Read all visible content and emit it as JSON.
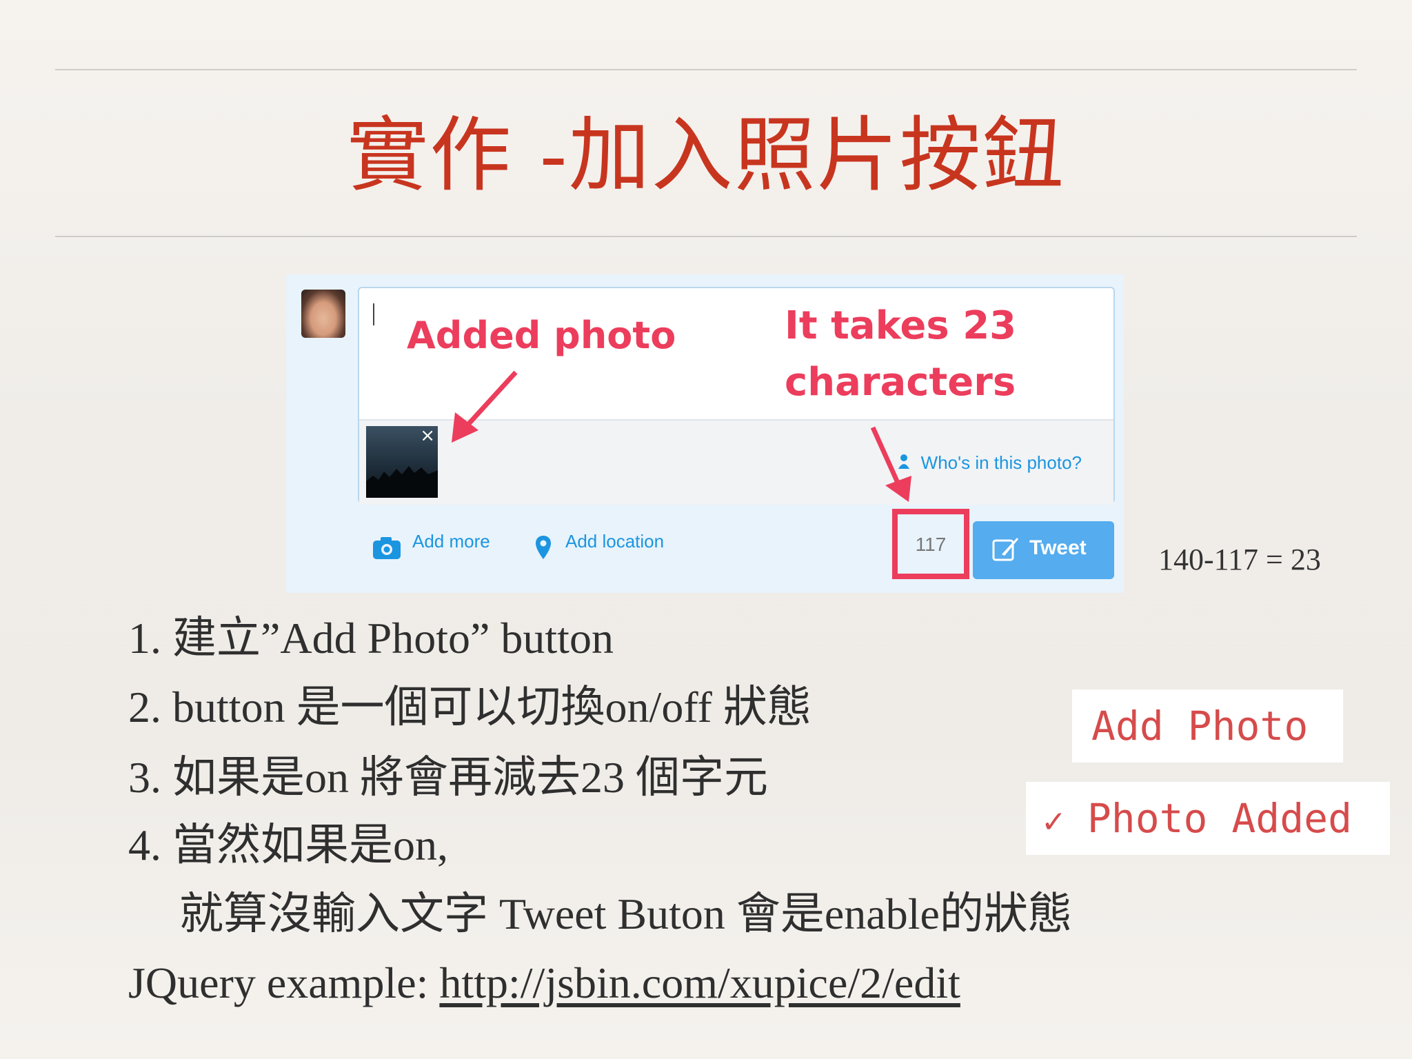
{
  "slide": {
    "title": "實作 -加入照片按鈕"
  },
  "tweet_composer": {
    "who_in_photo": "Who's in this photo?",
    "remove_photo_symbol": "×",
    "add_more_label": "Add more",
    "add_location_label": "Add location",
    "char_counter": "117",
    "tweet_button_label": "Tweet"
  },
  "annotations": {
    "added_photo": "Added photo",
    "takes_23_line1": "It takes 23",
    "takes_23_line2": "characters"
  },
  "calculation": "140-117 = 23",
  "steps": [
    "1. 建立”Add Photo” button",
    "2. button 是一個可以切換on/off 狀態",
    "3. 如果是on 將會再減去23 個字元",
    "4. 當然如果是on,",
    "就算沒輸入文字 Tweet Buton 會是enable的狀態"
  ],
  "jquery": {
    "prefix": "JQuery example: ",
    "link": "http://jsbin.com/xupice/2/edit"
  },
  "toggle_demo": {
    "off_label": "Add Photo",
    "on_check": "✓",
    "on_label": "Photo Added"
  },
  "colors": {
    "title_red": "#c8351f",
    "annotation_pink": "#ec3d5c",
    "twitter_blue": "#55acee",
    "link_blue": "#1b95e0",
    "demo_red": "#d64b4b"
  }
}
